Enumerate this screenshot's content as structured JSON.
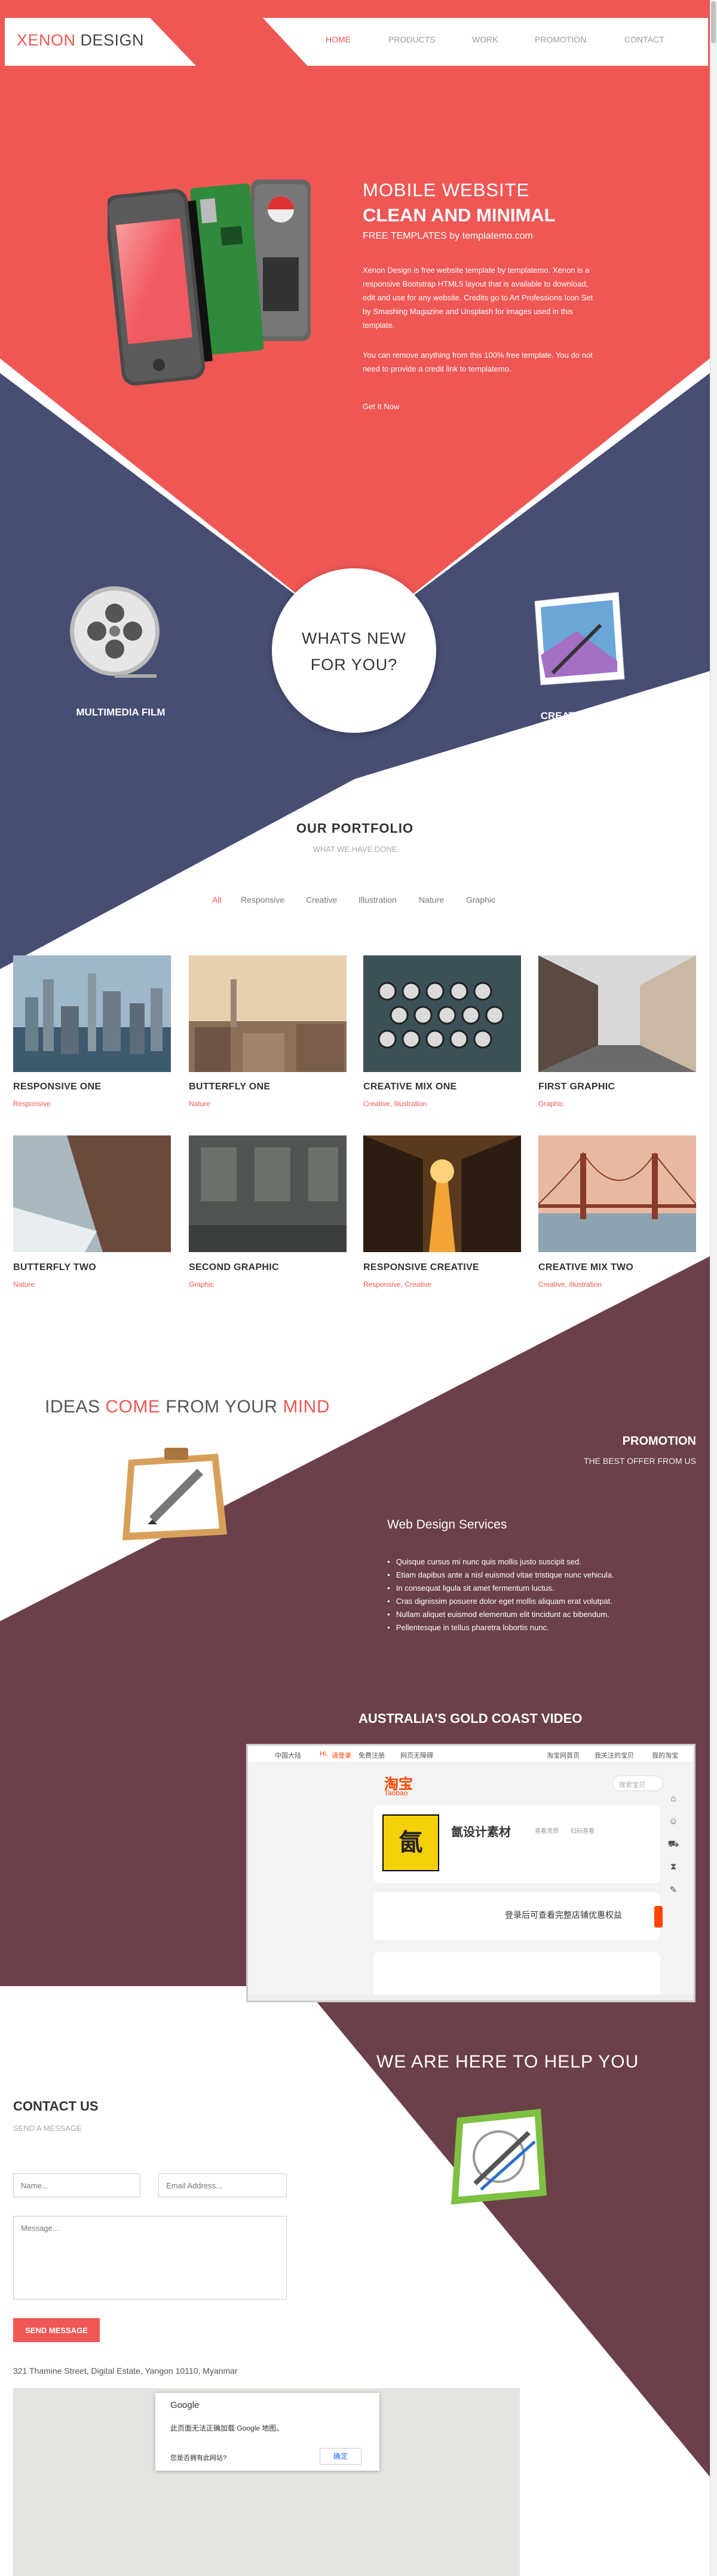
{
  "logo": {
    "part1": "XENON",
    "part2": " DESIGN"
  },
  "nav": [
    "HOME",
    "PRODUCTS",
    "WORK",
    "PROMOTION",
    "CONTACT"
  ],
  "hero": {
    "title": "MOBILE WEBSITE",
    "subtitle": "CLEAN AND MINIMAL",
    "tagline": "FREE TEMPLATES by templatemo.com",
    "p1": "Xenon Design is free website template by templatemo. Xenon is a responsive Bootstrap HTML5 layout that is available to download, edit and use for any website. Credits go to Art Professions Icon Set by Smashing Magazine and Unsplash for images used in this template.",
    "p2": "You can remove anything from this 100% free template. You do not need to provide a credit link to templatemo.",
    "link": "Get It Now"
  },
  "features": {
    "left": "MULTIMEDIA FILM",
    "circle1": "WHATS NEW",
    "circle2": "FOR YOU?",
    "right": "CREATIVE DESIGN"
  },
  "portfolio": {
    "title": "OUR PORTFOLIO",
    "subtitle": "WHAT WE HAVE DONE",
    "filters": [
      "All",
      "Responsive",
      "Creative",
      "Illustration",
      "Nature",
      "Graphic"
    ],
    "items": [
      {
        "title": "RESPONSIVE ONE",
        "category": "Responsive"
      },
      {
        "title": "BUTTERFLY ONE",
        "category": "Nature"
      },
      {
        "title": "CREATIVE MIX ONE",
        "category": "Creative, Illustration"
      },
      {
        "title": "FIRST GRAPHIC",
        "category": "Graphic"
      },
      {
        "title": "BUTTERFLY TWO",
        "category": "Nature"
      },
      {
        "title": "SECOND GRAPHIC",
        "category": "Graphic"
      },
      {
        "title": "RESPONSIVE CREATIVE",
        "category": "Responsive, Creative"
      },
      {
        "title": "CREATIVE MIX TWO",
        "category": "Creative, Illustration"
      }
    ]
  },
  "ideas": {
    "w1": "IDEAS ",
    "w2": "COME",
    "w3": " FROM YOUR ",
    "w4": "MIND"
  },
  "promotion": {
    "title": "PROMOTION",
    "subtitle": "THE BEST OFFER FROM US",
    "services_title": "Web Design Services",
    "services": [
      "Quisque cursus mi nunc quis mollis justo suscipit sed.",
      "Etiam dapibus ante a nisl euismod vitae tristique nunc vehicula.",
      "In consequat ligula sit amet fermentum luctus.",
      "Cras dignissim posuere dolor eget mollis aliquam erat volutpat.",
      "Nullam aliquet euismod elementum elit tincidunt ac bibendum.",
      "Pellentesque in tellus pharetra lobortis nunc."
    ]
  },
  "video": {
    "title": "AUSTRALIA'S GOLD COAST VIDEO",
    "topbar_left": "中国大陆",
    "topbar_hi": "Hi,",
    "topbar_login": "请登录",
    "topbar_register": "免费注册",
    "topbar_mobile": "网页无障碍",
    "topbar_right": [
      "淘宝网首页",
      "我关注的宝贝",
      "我的淘宝"
    ],
    "brand_cn": "淘宝",
    "brand_en": "Taobao",
    "search_placeholder": "搜索宝贝",
    "shop_name": "氤设计素材",
    "shop_meta1": "查看资质",
    "shop_meta2": "扫码查看",
    "login_tip": "登录后可查看完整店铺优惠权益"
  },
  "help": "WE ARE HERE TO HELP YOU",
  "contact": {
    "title": "CONTACT US",
    "subtitle": "SEND A MESSAGE",
    "name_placeholder": "Name...",
    "email_placeholder": "Email Address...",
    "message_placeholder": "Message...",
    "send": "SEND MESSAGE",
    "address": "321 Thamine Street, Digital Estate, Yangon 10110, Myanmar"
  },
  "map": {
    "brand": "Google",
    "error": "此页面无法正确加载 Google 地图。",
    "question": "您是否拥有此网站?",
    "ok": "确定"
  },
  "colors": {
    "accent": "#ef5755",
    "navy": "#464e74",
    "maroon": "#6b4049"
  }
}
